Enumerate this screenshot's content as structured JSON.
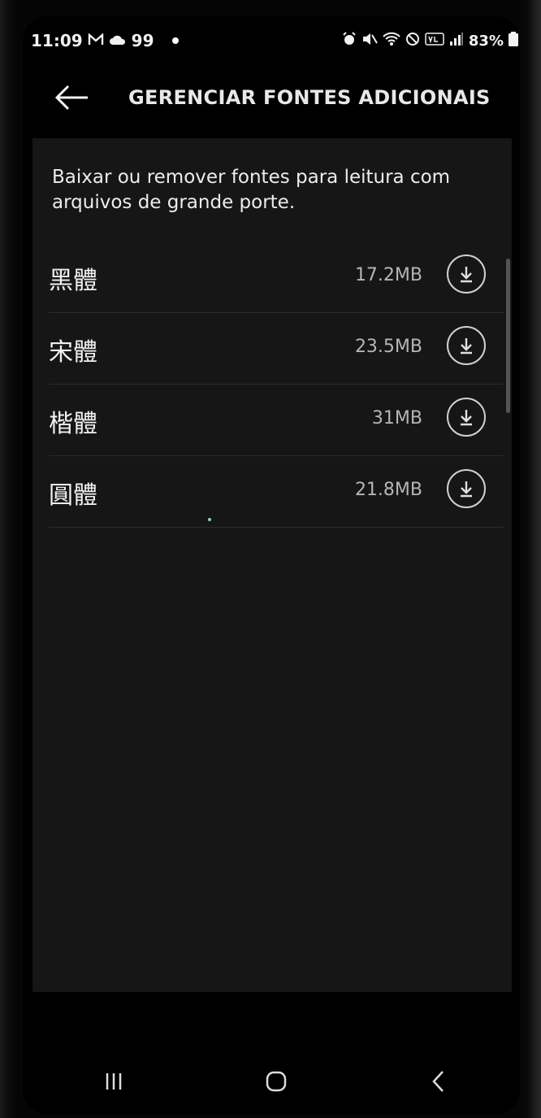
{
  "status_bar": {
    "time": "11:09",
    "notif": "99",
    "battery": "83%"
  },
  "header": {
    "title": "GERENCIAR FONTES ADICIONAIS"
  },
  "description": "Baixar ou remover fontes para leitura com arquivos de grande porte.",
  "fonts": [
    {
      "name": "黑體",
      "size": "17.2MB"
    },
    {
      "name": "宋體",
      "size": "23.5MB"
    },
    {
      "name": "楷體",
      "size": "31MB"
    },
    {
      "name": "圓體",
      "size": "21.8MB"
    }
  ],
  "icons": {
    "back": "arrow-left-icon",
    "download": "download-icon",
    "recents": "recents-icon",
    "home": "home-icon",
    "nav_back": "chevron-left-icon"
  },
  "colors": {
    "background": "#000000",
    "panel": "#161616",
    "text": "#ececec",
    "muted": "#b5b5b5"
  }
}
